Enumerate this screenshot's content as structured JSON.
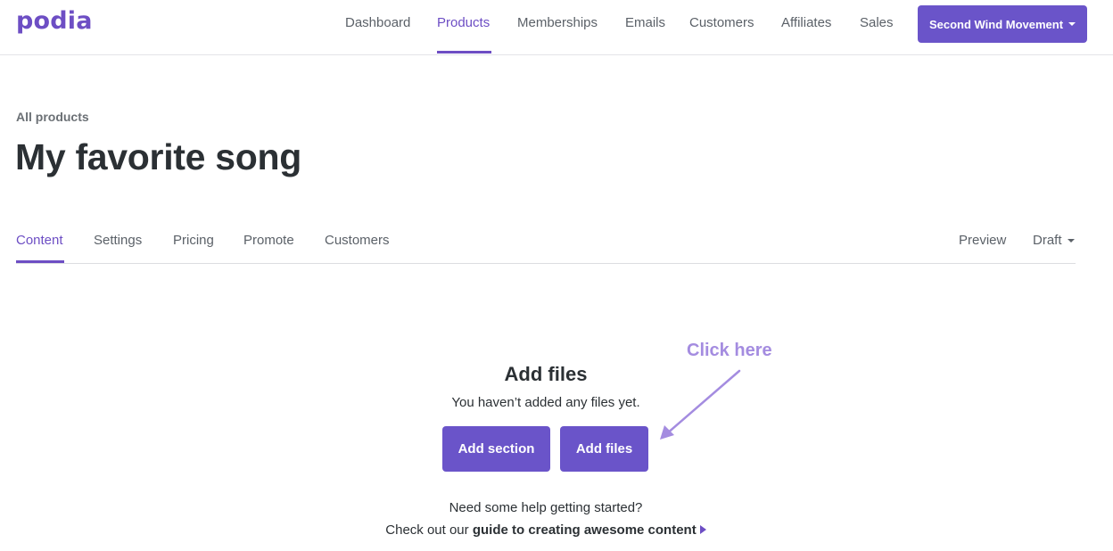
{
  "brand": {
    "logo_text": "podia",
    "accent": "#6a54c9"
  },
  "nav": {
    "items": [
      {
        "label": "Dashboard"
      },
      {
        "label": "Products",
        "active": true
      },
      {
        "label": "Memberships"
      },
      {
        "label": "Emails"
      },
      {
        "label": "Customers"
      },
      {
        "label": "Affiliates"
      },
      {
        "label": "Sales"
      }
    ],
    "store_button": "Second Wind Movement"
  },
  "breadcrumb": "All products",
  "page_title": "My favorite song",
  "tabs": {
    "items": [
      {
        "label": "Content",
        "active": true
      },
      {
        "label": "Settings"
      },
      {
        "label": "Pricing"
      },
      {
        "label": "Promote"
      },
      {
        "label": "Customers"
      }
    ],
    "preview": "Preview",
    "status": "Draft"
  },
  "empty_state": {
    "title": "Add files",
    "text": "You haven’t added any files yet.",
    "add_section_button": "Add section",
    "add_files_button": "Add files"
  },
  "annotation": {
    "text": "Click here",
    "color": "#a48ce0"
  },
  "help": {
    "line1": "Need some help getting started?",
    "line2_prefix": "Check out our ",
    "link_text": "guide to creating awesome content"
  }
}
